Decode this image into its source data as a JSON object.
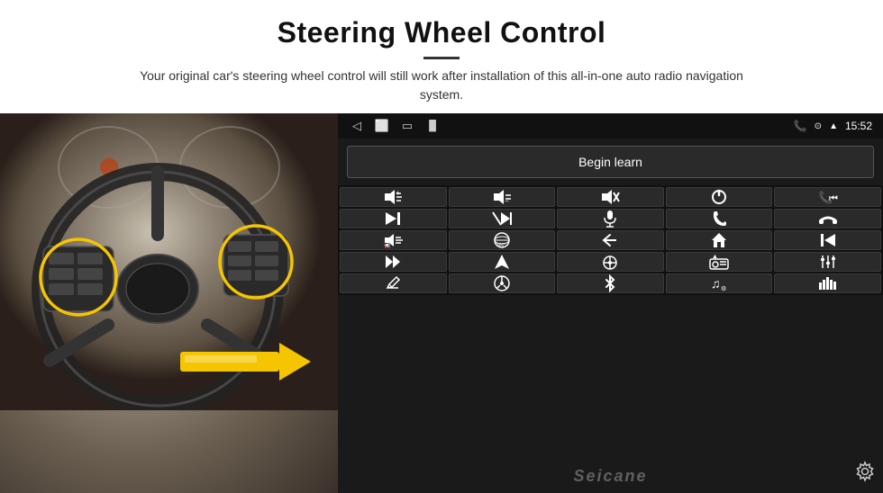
{
  "header": {
    "title": "Steering Wheel Control",
    "subtitle": "Your original car's steering wheel control will still work after installation of this all-in-one auto radio navigation system.",
    "divider_visible": true
  },
  "status_bar": {
    "time": "15:52",
    "icons": [
      "phone",
      "location",
      "wifi",
      "battery"
    ]
  },
  "begin_learn": {
    "label": "Begin learn"
  },
  "control_buttons": [
    {
      "icon": "vol_up",
      "symbol": "🔊+"
    },
    {
      "icon": "vol_down",
      "symbol": "🔉-"
    },
    {
      "icon": "mute",
      "symbol": "🔇"
    },
    {
      "icon": "power",
      "symbol": "⏻"
    },
    {
      "icon": "phone_end",
      "symbol": "📞⏮"
    },
    {
      "icon": "next_track",
      "symbol": "⏭"
    },
    {
      "icon": "mute_mic",
      "symbol": "⏭✕"
    },
    {
      "icon": "mic",
      "symbol": "🎤"
    },
    {
      "icon": "phone",
      "symbol": "📞"
    },
    {
      "icon": "hang_up",
      "symbol": "↩"
    },
    {
      "icon": "horn",
      "symbol": "📢"
    },
    {
      "icon": "360_cam",
      "symbol": "360°"
    },
    {
      "icon": "back",
      "symbol": "↩"
    },
    {
      "icon": "home",
      "symbol": "⌂"
    },
    {
      "icon": "prev_track2",
      "symbol": "⏮"
    },
    {
      "icon": "fast_fwd",
      "symbol": "⏭"
    },
    {
      "icon": "nav",
      "symbol": "▶"
    },
    {
      "icon": "eject",
      "symbol": "⏏"
    },
    {
      "icon": "radio",
      "symbol": "📻"
    },
    {
      "icon": "eq",
      "symbol": "🎛"
    },
    {
      "icon": "pen",
      "symbol": "✏"
    },
    {
      "icon": "wheel",
      "symbol": "⊙"
    },
    {
      "icon": "bluetooth",
      "symbol": "⚡"
    },
    {
      "icon": "music",
      "symbol": "♪"
    },
    {
      "icon": "bars",
      "symbol": "▐▌"
    }
  ],
  "watermark": "Seicane",
  "grid_cols": 5,
  "grid_rows": 5
}
